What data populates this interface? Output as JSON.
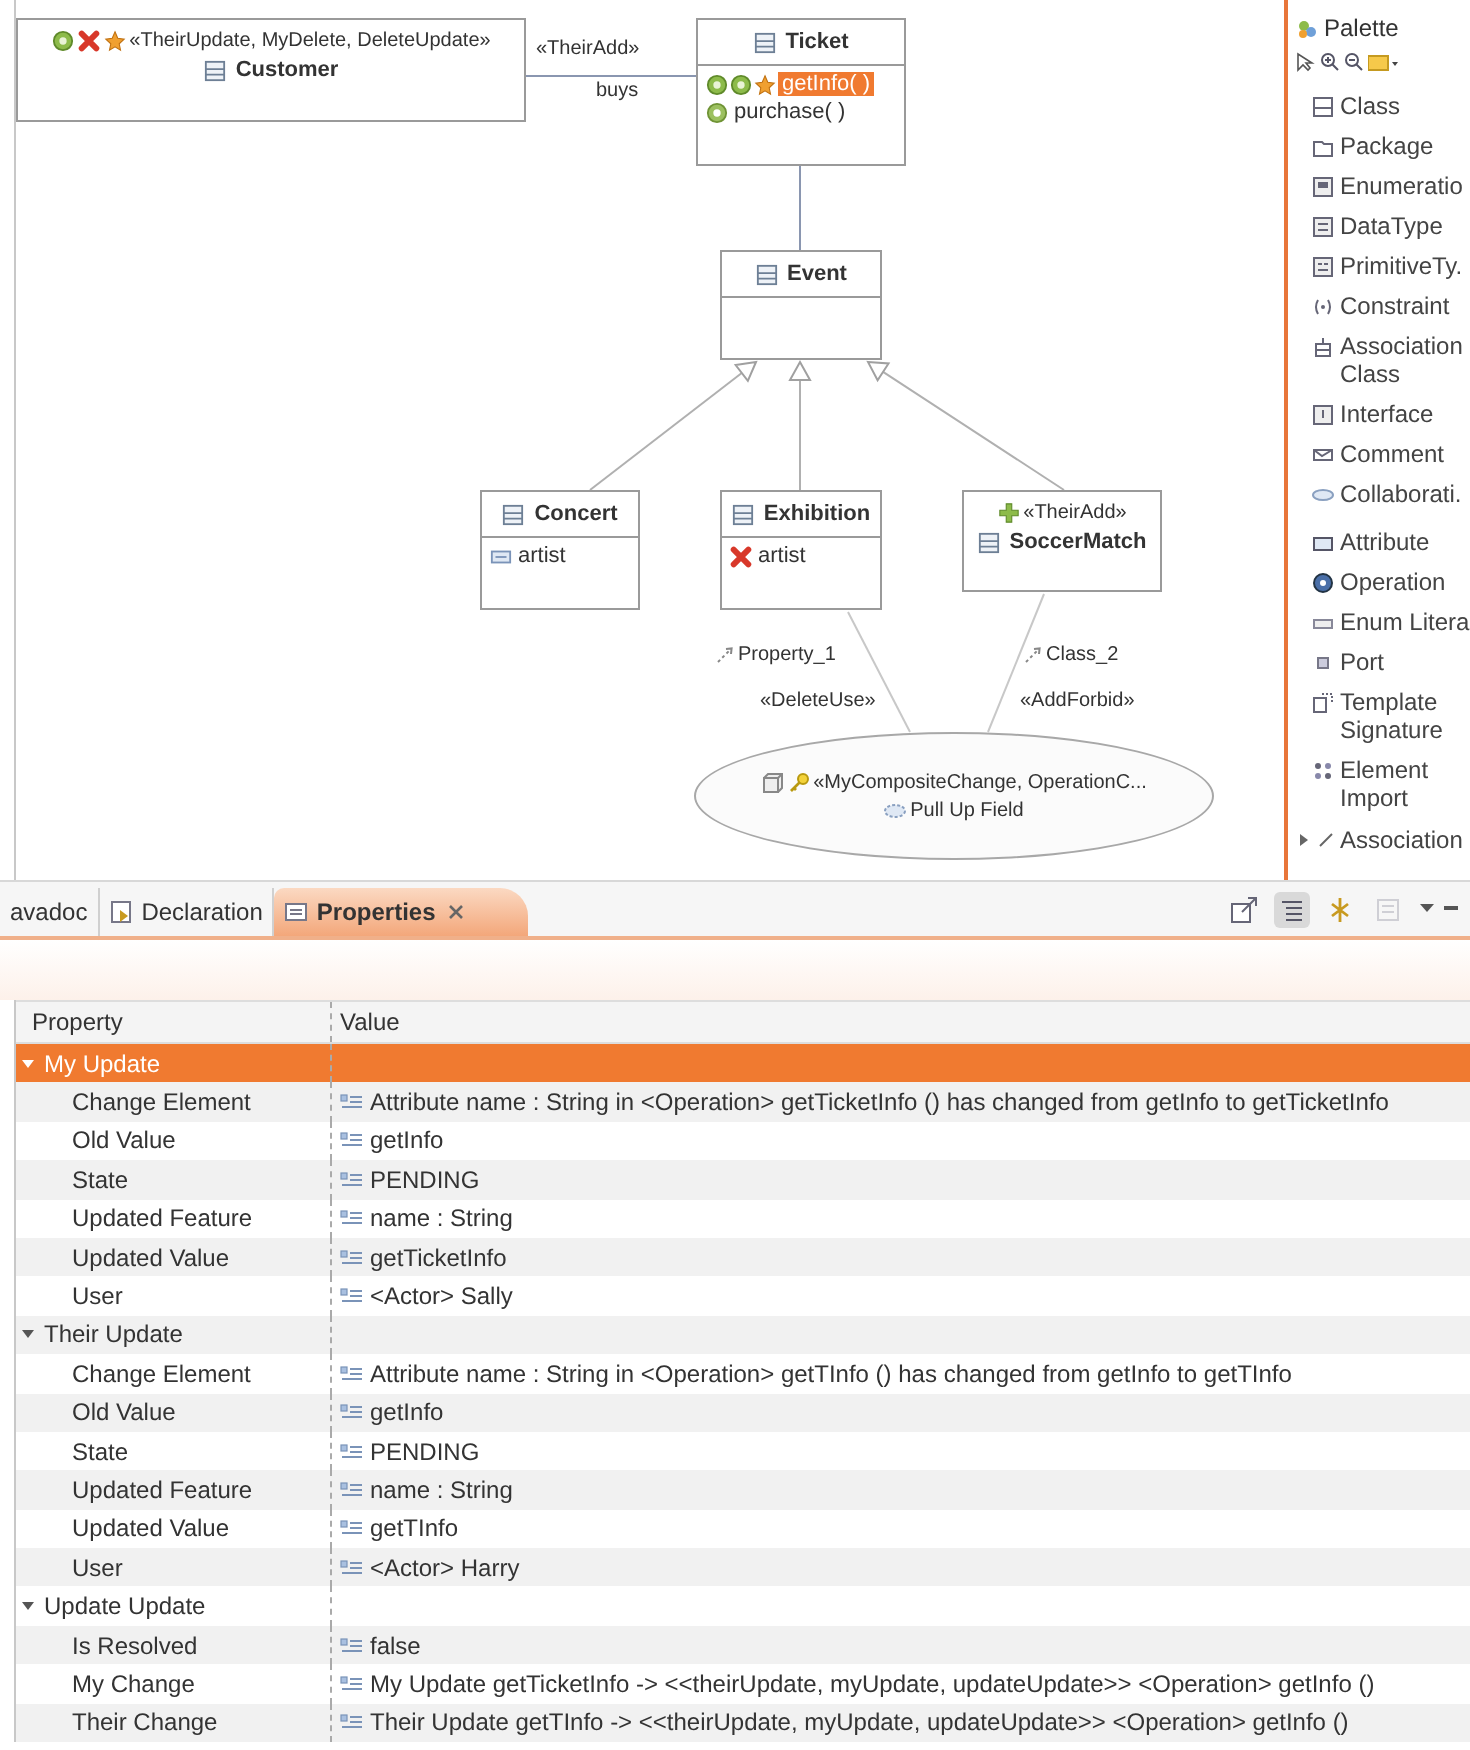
{
  "diagram": {
    "nodes": [
      {
        "name": "Customer",
        "stereotype": "«TheirUpdate, MyDelete, DeleteUpdate»"
      },
      {
        "name": "Ticket",
        "members": [
          {
            "label": "getInfo( )",
            "selected": true
          },
          {
            "label": "purchase( )",
            "selected": false
          }
        ]
      },
      {
        "name": "Event"
      },
      {
        "name": "Concert",
        "members": [
          {
            "label": "artist",
            "selected": false
          }
        ]
      },
      {
        "name": "Exhibition",
        "members": [
          {
            "label": "artist",
            "selected": false
          }
        ]
      },
      {
        "name": "SoccerMatch",
        "stereotype": "«TheirAdd»"
      }
    ],
    "association": {
      "stereotype": "«TheirAdd»",
      "label": "buys"
    },
    "dependencies": [
      {
        "name": "Property_1",
        "stereotype": "«DeleteUse»"
      },
      {
        "name": "Class_2",
        "stereotype": "«AddForbid»"
      }
    ],
    "collaboration": {
      "stereotype": "«MyCompositeChange, OperationC...",
      "name": "Pull Up Field"
    }
  },
  "palette": {
    "title": "Palette",
    "tool_groups": [
      [
        "Class",
        "Package",
        "Enumeratio",
        "DataType",
        "PrimitiveTy.",
        "Constraint",
        "Association Class",
        "Interface",
        "Comment",
        "Collaborati."
      ],
      [
        "Attribute",
        "Operation",
        "Enum Litera",
        "Port",
        "Template Signature",
        "Element Import"
      ]
    ],
    "drawer": {
      "label": "Association",
      "expanded": false
    }
  },
  "properties_view": {
    "tabs": [
      {
        "label": "avadoc",
        "selected": false,
        "closable": false
      },
      {
        "label": "Declaration",
        "selected": false,
        "closable": false
      },
      {
        "label": "Properties",
        "selected": true,
        "closable": true
      }
    ],
    "toolbar": [
      {
        "pressed": false,
        "disabled": false
      },
      {
        "pressed": true,
        "disabled": false
      },
      {
        "pressed": false,
        "disabled": false
      },
      {
        "pressed": false,
        "disabled": true
      }
    ],
    "columns": [
      "Property",
      "Value"
    ],
    "groups": [
      {
        "label": "My Update",
        "expanded": true,
        "selected": true,
        "rows": [
          {
            "property": "Change Element",
            "value": "Attribute name : String in <Operation> getTicketInfo () has changed from getInfo to getTicketInfo"
          },
          {
            "property": "Old Value",
            "value": "getInfo"
          },
          {
            "property": "State",
            "value": "PENDING"
          },
          {
            "property": "Updated Feature",
            "value": "name : String"
          },
          {
            "property": "Updated Value",
            "value": "getTicketInfo"
          },
          {
            "property": "User",
            "value": "<Actor> Sally"
          }
        ]
      },
      {
        "label": "Their Update",
        "expanded": true,
        "selected": false,
        "rows": [
          {
            "property": "Change Element",
            "value": "Attribute name : String in <Operation> getTInfo () has changed from getInfo to getTInfo"
          },
          {
            "property": "Old Value",
            "value": "getInfo"
          },
          {
            "property": "State",
            "value": "PENDING"
          },
          {
            "property": "Updated Feature",
            "value": "name : String"
          },
          {
            "property": "Updated Value",
            "value": "getTInfo"
          },
          {
            "property": "User",
            "value": "<Actor> Harry"
          }
        ]
      },
      {
        "label": "Update Update",
        "expanded": true,
        "selected": false,
        "rows": [
          {
            "property": "Is Resolved",
            "value": "false"
          },
          {
            "property": "My Change",
            "value": "My Update getTicketInfo -> <<theirUpdate, myUpdate, updateUpdate>> <Operation> getInfo ()"
          },
          {
            "property": "Their Change",
            "value": "Their Update getTInfo -> <<theirUpdate, myUpdate, updateUpdate>> <Operation> getInfo ()"
          }
        ]
      }
    ]
  }
}
